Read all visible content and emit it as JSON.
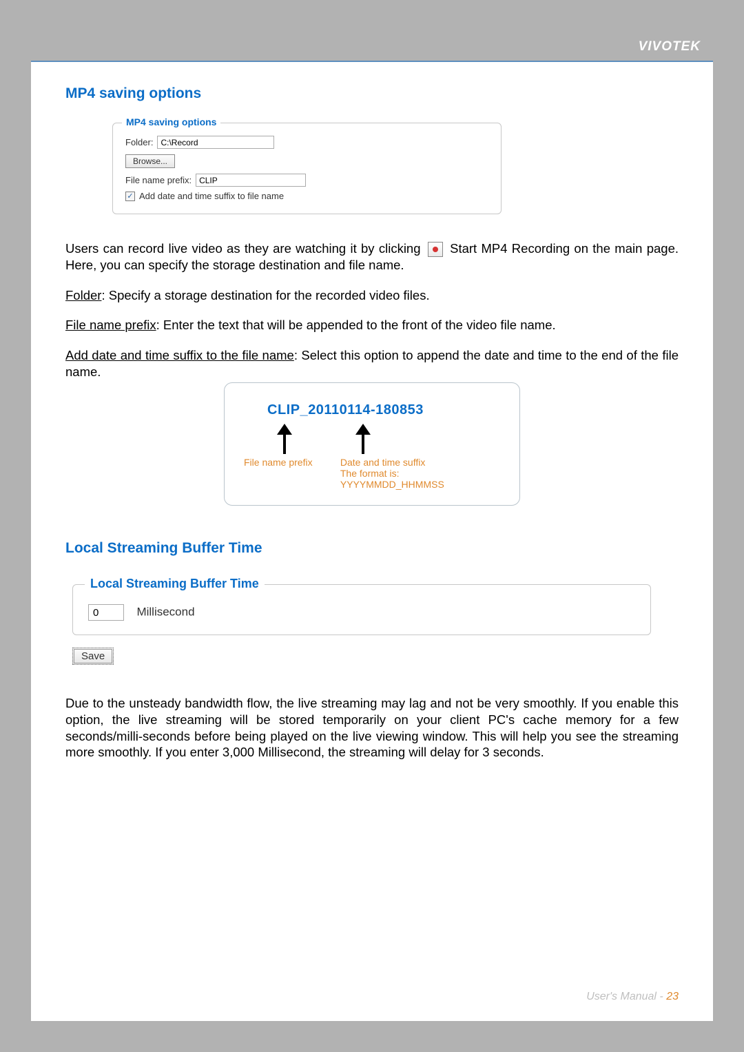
{
  "brand": "VIVOTEK",
  "sections": {
    "mp4_title": "MP4 saving options",
    "lsbt_title": "Local Streaming Buffer Time"
  },
  "mp4_panel": {
    "legend": "MP4 saving options",
    "folder_label": "Folder:",
    "folder_value": "C:\\Record",
    "browse_label": "Browse...",
    "prefix_label": "File name prefix:",
    "prefix_value": "CLIP",
    "suffix_checkbox_label": "Add date and time suffix to file name",
    "suffix_checked_mark": "✓"
  },
  "paragraphs": {
    "p1_a": "Users can record live video as they are watching it by clicking",
    "p1_b": "Start MP4 Recording on the main page. Here, you can specify the storage destination and file name.",
    "p2_label": "Folder",
    "p2_rest": ": Specify a storage destination for the recorded video files.",
    "p3_label": "File name prefix",
    "p3_rest": ": Enter the text that will be appended to the front of the video file name.",
    "p4_label": "Add date and time suffix to the file name",
    "p4_rest": ": Select this option to append the date and time to the end of the file name.",
    "lsbt_body": "Due to the unsteady bandwidth flow, the live streaming may lag and not be very smoothly. If you enable this option, the live streaming will be stored temporarily on your client PC's cache memory for a few seconds/milli-seconds before being played on the live viewing window. This will help you see the streaming more smoothly. If you enter 3,000 Millisecond, the streaming will delay for 3 seconds."
  },
  "diagram": {
    "prefix": "CLIP_",
    "suffix": "20110114-180853",
    "label_prefix": "File name prefix",
    "label_suffix1": "Date and time suffix",
    "label_suffix2": "The format is: YYYYMMDD_HHMMSS"
  },
  "lsbt_panel": {
    "legend": "Local Streaming Buffer Time",
    "value": "0",
    "unit": "Millisecond",
    "save_label": "Save"
  },
  "footer": {
    "manual": "User's Manual - ",
    "page": "23"
  }
}
